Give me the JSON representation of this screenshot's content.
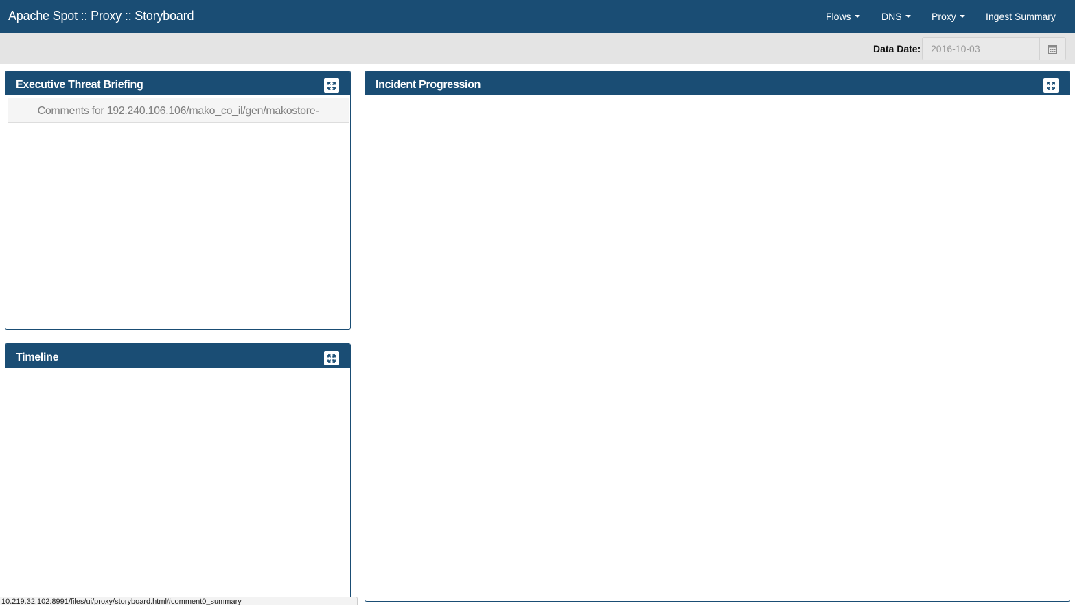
{
  "navbar": {
    "brand": "Apache Spot :: Proxy :: Storyboard",
    "menu": [
      {
        "label": "Flows",
        "dropdown": true
      },
      {
        "label": "DNS",
        "dropdown": true
      },
      {
        "label": "Proxy",
        "dropdown": true
      },
      {
        "label": "Ingest Summary",
        "dropdown": false
      }
    ]
  },
  "date_filter": {
    "label": "Data Date:",
    "value": "2016-10-03",
    "icon": "calendar-icon"
  },
  "panels": {
    "briefing": {
      "title": "Executive Threat Briefing",
      "expand_icon": "expand-icon",
      "items": [
        {
          "text": "Comments for 192.240.106.106/mako_co_il/gen/makostore-"
        }
      ]
    },
    "timeline": {
      "title": "Timeline",
      "expand_icon": "expand-icon"
    },
    "progression": {
      "title": "Incident Progression",
      "expand_icon": "expand-icon"
    }
  },
  "status_bar": {
    "url": "10.219.32.102:8991/files/ui/proxy/storyboard.html#comment0_summary"
  },
  "colors": {
    "primary": "#1a4d74",
    "subbar": "#e4e4e4",
    "link": "#808080"
  }
}
